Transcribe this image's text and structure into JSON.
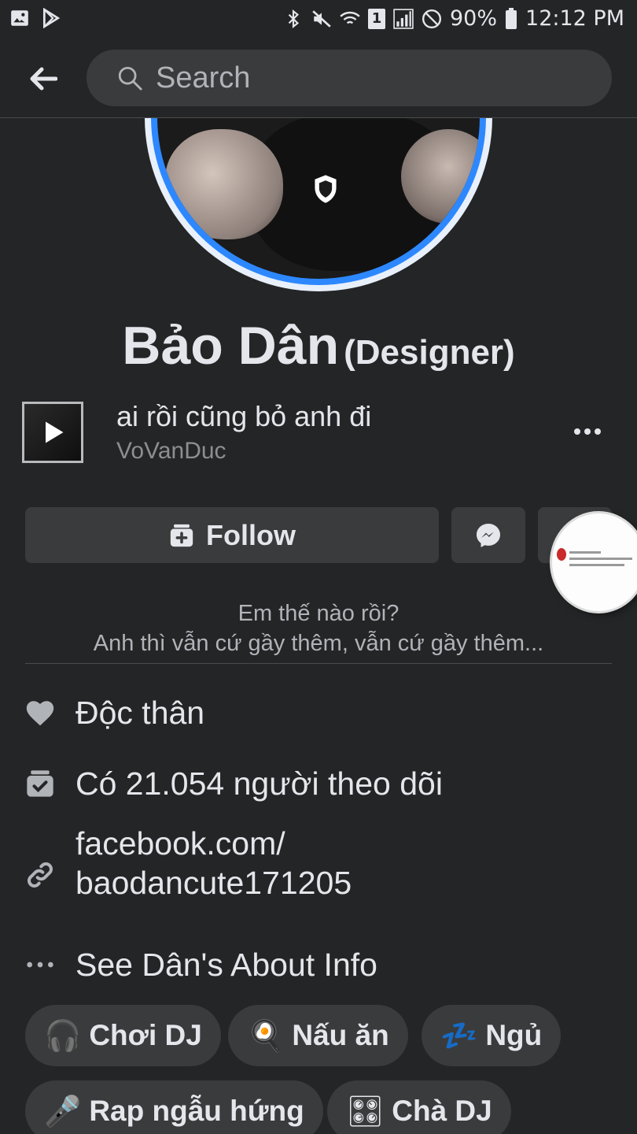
{
  "status_bar": {
    "battery": "90%",
    "time": "12:12 PM",
    "sim": "1"
  },
  "search": {
    "placeholder": "Search"
  },
  "profile": {
    "name": "Bảo Dân",
    "alt_name": "(Designer)"
  },
  "music": {
    "title": "ai rồi cũng bỏ anh đi",
    "artist": "VoVanDuc"
  },
  "actions": {
    "follow_label": "Follow"
  },
  "bio": {
    "line1": "Em thế nào rồi?",
    "line2": "Anh thì vẫn cứ gầy thêm, vẫn cứ gầy thêm..."
  },
  "info": {
    "relationship": "Độc thân",
    "followers": "Có 21.054 người theo dõi",
    "link_line1": "facebook.com/",
    "link_line2": "baodancute171205",
    "about": "See Dân's About Info"
  },
  "hobbies": [
    {
      "label": "Chơi DJ",
      "emoji": "🎧"
    },
    {
      "label": "Nấu ăn",
      "emoji": "🍳"
    },
    {
      "label": "Ngủ",
      "emoji": "💤"
    },
    {
      "label": "Rap ngẫu hứng",
      "emoji": "🎤"
    },
    {
      "label": "Chà DJ",
      "emoji": "🎛"
    }
  ],
  "colors": {
    "background": "#242526",
    "surface": "#3a3b3c",
    "accent": "#2d88ff",
    "text_primary": "#e4e6eb",
    "text_secondary": "#b0b3b8"
  }
}
